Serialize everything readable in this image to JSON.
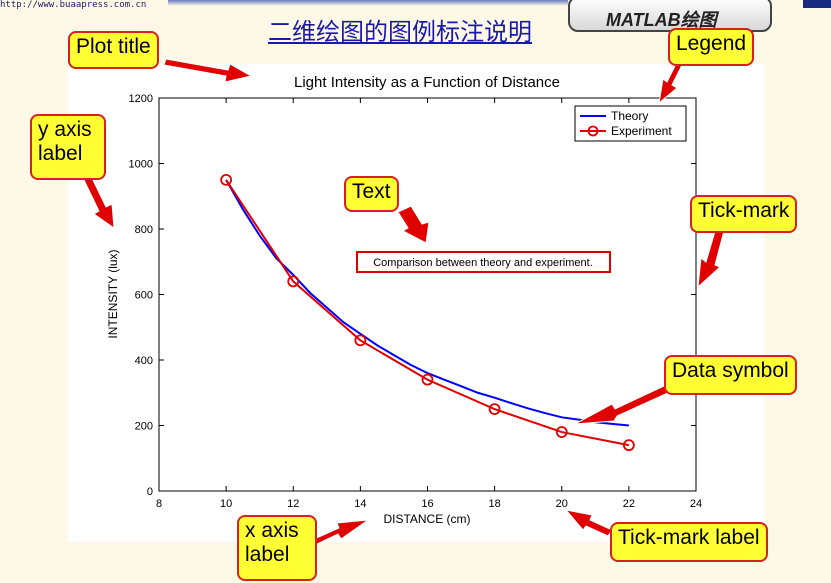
{
  "header": {
    "url": "http://www.buaapress.com.cn",
    "title": "二维绘图的图例标注说明",
    "tab_label": "MATLAB绘图"
  },
  "callouts": {
    "plot_title": "Plot title",
    "legend": "Legend",
    "y_axis_label_1": "y axis",
    "y_axis_label_2": "label",
    "text": "Text",
    "tick_mark": "Tick-mark",
    "data_symbol": "Data symbol",
    "x_axis_label_1": "x axis",
    "x_axis_label_2": "label",
    "tick_mark_label": "Tick-mark label"
  },
  "colors": {
    "theory": "#0000ff",
    "experiment": "#e00000",
    "callout_fill": "#ffff33",
    "callout_border": "#d82020",
    "arrow": "#e00000"
  },
  "chart_data": {
    "type": "line",
    "title": "Light Intensity as a Function of Distance",
    "xlabel": "DISTANCE (cm)",
    "ylabel": "INTENSITY (lux)",
    "xlim": [
      8,
      24
    ],
    "ylim": [
      0,
      1200
    ],
    "xticks": [
      8,
      10,
      12,
      14,
      16,
      18,
      20,
      22,
      24
    ],
    "yticks": [
      0,
      200,
      400,
      600,
      800,
      1000,
      1200
    ],
    "annotation": "Comparison between theory and experiment.",
    "legend_position": "top-right",
    "grid": false,
    "series": [
      {
        "name": "Theory",
        "marker": "none",
        "x": [
          10,
          10.5,
          11,
          11.5,
          12,
          12.5,
          13,
          13.5,
          14,
          14.5,
          15,
          15.5,
          16,
          16.5,
          17,
          17.5,
          18,
          18.5,
          19,
          19.5,
          20,
          20.5,
          21,
          21.5,
          22
        ],
        "y": [
          950,
          860,
          780,
          710,
          660,
          605,
          560,
          515,
          480,
          445,
          415,
          385,
          360,
          340,
          320,
          300,
          285,
          268,
          252,
          238,
          225,
          218,
          210,
          205,
          200
        ]
      },
      {
        "name": "Experiment",
        "marker": "circle",
        "x": [
          10,
          12,
          14,
          16,
          18,
          20,
          22
        ],
        "y": [
          950,
          640,
          460,
          340,
          250,
          180,
          140
        ]
      }
    ]
  }
}
